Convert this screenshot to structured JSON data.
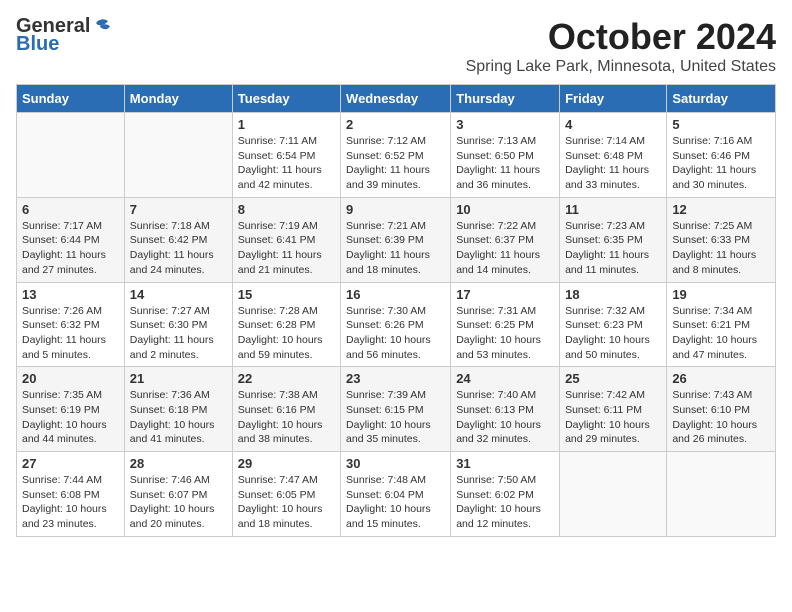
{
  "logo": {
    "general": "General",
    "blue": "Blue"
  },
  "title": "October 2024",
  "location": "Spring Lake Park, Minnesota, United States",
  "weekdays": [
    "Sunday",
    "Monday",
    "Tuesday",
    "Wednesday",
    "Thursday",
    "Friday",
    "Saturday"
  ],
  "weeks": [
    [
      {
        "day": "",
        "info": ""
      },
      {
        "day": "",
        "info": ""
      },
      {
        "day": "1",
        "info": "Sunrise: 7:11 AM\nSunset: 6:54 PM\nDaylight: 11 hours and 42 minutes."
      },
      {
        "day": "2",
        "info": "Sunrise: 7:12 AM\nSunset: 6:52 PM\nDaylight: 11 hours and 39 minutes."
      },
      {
        "day": "3",
        "info": "Sunrise: 7:13 AM\nSunset: 6:50 PM\nDaylight: 11 hours and 36 minutes."
      },
      {
        "day": "4",
        "info": "Sunrise: 7:14 AM\nSunset: 6:48 PM\nDaylight: 11 hours and 33 minutes."
      },
      {
        "day": "5",
        "info": "Sunrise: 7:16 AM\nSunset: 6:46 PM\nDaylight: 11 hours and 30 minutes."
      }
    ],
    [
      {
        "day": "6",
        "info": "Sunrise: 7:17 AM\nSunset: 6:44 PM\nDaylight: 11 hours and 27 minutes."
      },
      {
        "day": "7",
        "info": "Sunrise: 7:18 AM\nSunset: 6:42 PM\nDaylight: 11 hours and 24 minutes."
      },
      {
        "day": "8",
        "info": "Sunrise: 7:19 AM\nSunset: 6:41 PM\nDaylight: 11 hours and 21 minutes."
      },
      {
        "day": "9",
        "info": "Sunrise: 7:21 AM\nSunset: 6:39 PM\nDaylight: 11 hours and 18 minutes."
      },
      {
        "day": "10",
        "info": "Sunrise: 7:22 AM\nSunset: 6:37 PM\nDaylight: 11 hours and 14 minutes."
      },
      {
        "day": "11",
        "info": "Sunrise: 7:23 AM\nSunset: 6:35 PM\nDaylight: 11 hours and 11 minutes."
      },
      {
        "day": "12",
        "info": "Sunrise: 7:25 AM\nSunset: 6:33 PM\nDaylight: 11 hours and 8 minutes."
      }
    ],
    [
      {
        "day": "13",
        "info": "Sunrise: 7:26 AM\nSunset: 6:32 PM\nDaylight: 11 hours and 5 minutes."
      },
      {
        "day": "14",
        "info": "Sunrise: 7:27 AM\nSunset: 6:30 PM\nDaylight: 11 hours and 2 minutes."
      },
      {
        "day": "15",
        "info": "Sunrise: 7:28 AM\nSunset: 6:28 PM\nDaylight: 10 hours and 59 minutes."
      },
      {
        "day": "16",
        "info": "Sunrise: 7:30 AM\nSunset: 6:26 PM\nDaylight: 10 hours and 56 minutes."
      },
      {
        "day": "17",
        "info": "Sunrise: 7:31 AM\nSunset: 6:25 PM\nDaylight: 10 hours and 53 minutes."
      },
      {
        "day": "18",
        "info": "Sunrise: 7:32 AM\nSunset: 6:23 PM\nDaylight: 10 hours and 50 minutes."
      },
      {
        "day": "19",
        "info": "Sunrise: 7:34 AM\nSunset: 6:21 PM\nDaylight: 10 hours and 47 minutes."
      }
    ],
    [
      {
        "day": "20",
        "info": "Sunrise: 7:35 AM\nSunset: 6:19 PM\nDaylight: 10 hours and 44 minutes."
      },
      {
        "day": "21",
        "info": "Sunrise: 7:36 AM\nSunset: 6:18 PM\nDaylight: 10 hours and 41 minutes."
      },
      {
        "day": "22",
        "info": "Sunrise: 7:38 AM\nSunset: 6:16 PM\nDaylight: 10 hours and 38 minutes."
      },
      {
        "day": "23",
        "info": "Sunrise: 7:39 AM\nSunset: 6:15 PM\nDaylight: 10 hours and 35 minutes."
      },
      {
        "day": "24",
        "info": "Sunrise: 7:40 AM\nSunset: 6:13 PM\nDaylight: 10 hours and 32 minutes."
      },
      {
        "day": "25",
        "info": "Sunrise: 7:42 AM\nSunset: 6:11 PM\nDaylight: 10 hours and 29 minutes."
      },
      {
        "day": "26",
        "info": "Sunrise: 7:43 AM\nSunset: 6:10 PM\nDaylight: 10 hours and 26 minutes."
      }
    ],
    [
      {
        "day": "27",
        "info": "Sunrise: 7:44 AM\nSunset: 6:08 PM\nDaylight: 10 hours and 23 minutes."
      },
      {
        "day": "28",
        "info": "Sunrise: 7:46 AM\nSunset: 6:07 PM\nDaylight: 10 hours and 20 minutes."
      },
      {
        "day": "29",
        "info": "Sunrise: 7:47 AM\nSunset: 6:05 PM\nDaylight: 10 hours and 18 minutes."
      },
      {
        "day": "30",
        "info": "Sunrise: 7:48 AM\nSunset: 6:04 PM\nDaylight: 10 hours and 15 minutes."
      },
      {
        "day": "31",
        "info": "Sunrise: 7:50 AM\nSunset: 6:02 PM\nDaylight: 10 hours and 12 minutes."
      },
      {
        "day": "",
        "info": ""
      },
      {
        "day": "",
        "info": ""
      }
    ]
  ]
}
